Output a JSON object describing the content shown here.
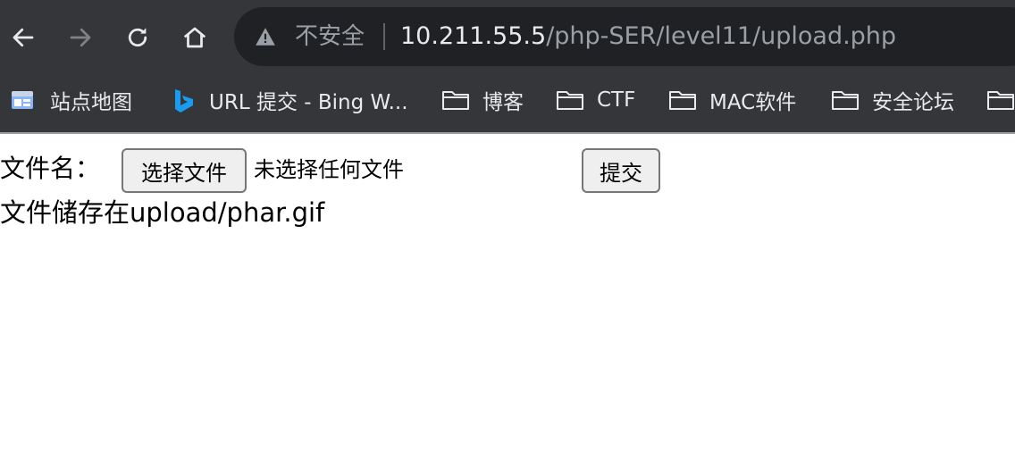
{
  "browser": {
    "nav": {
      "back_icon": "arrow-left-icon",
      "forward_icon": "arrow-right-icon",
      "reload_icon": "reload-icon",
      "home_icon": "home-icon"
    },
    "address_bar": {
      "security_icon": "warning-triangle-icon",
      "security_label": "不安全",
      "url_host": "10.211.55.5",
      "url_path": "/php-SER/level11/upload.php"
    },
    "bookmarks": [
      {
        "label": "站点地图",
        "icon": "sitemap-icon"
      },
      {
        "label": "URL 提交 - Bing W...",
        "icon": "bing-icon"
      },
      {
        "label": "博客",
        "icon": "folder-icon"
      },
      {
        "label": "CTF",
        "icon": "folder-icon"
      },
      {
        "label": "MAC软件",
        "icon": "folder-icon"
      },
      {
        "label": "安全论坛",
        "icon": "folder-icon"
      }
    ]
  },
  "page": {
    "file_label": "文件名：",
    "choose_file_button": "选择文件",
    "no_file_text": "未选择任何文件",
    "submit_button": "提交",
    "result_text": "文件储存在upload/phar.gif"
  },
  "colors": {
    "chrome_bg": "#35363a",
    "omnibox_bg": "#202124",
    "text_light": "#e8eaed",
    "text_muted": "#9aa0a6"
  }
}
